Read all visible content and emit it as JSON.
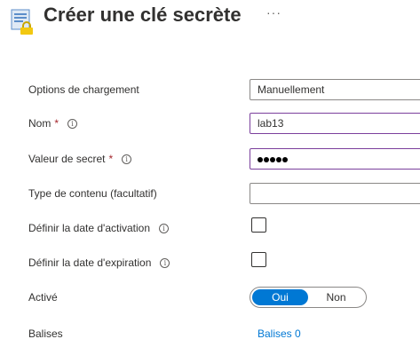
{
  "header": {
    "title": "Créer une clé secrète",
    "more_label": "···"
  },
  "form": {
    "upload": {
      "label": "Options de chargement",
      "value": "Manuellement"
    },
    "name": {
      "label": "Nom",
      "required_mark": "*",
      "value": "lab13"
    },
    "secret": {
      "label": "Valeur de secret",
      "required_mark": "*",
      "masked_length": 5
    },
    "content_type": {
      "label": "Type de contenu (facultatif)",
      "value": ""
    },
    "activation": {
      "label": "Définir la date d'activation",
      "checked": false
    },
    "expiration": {
      "label": "Définir la date d'expiration",
      "checked": false
    },
    "enabled": {
      "label": "Activé",
      "on_label": "Oui",
      "off_label": "Non",
      "selected": "Oui"
    },
    "tags": {
      "label": "Balises",
      "link_label": "Balises 0"
    }
  },
  "icons": {
    "info": "info-icon",
    "header": "key-document-icon"
  },
  "colors": {
    "accent": "#0078d4",
    "required": "#a4262c",
    "focus_border": "#7b3f9c"
  }
}
